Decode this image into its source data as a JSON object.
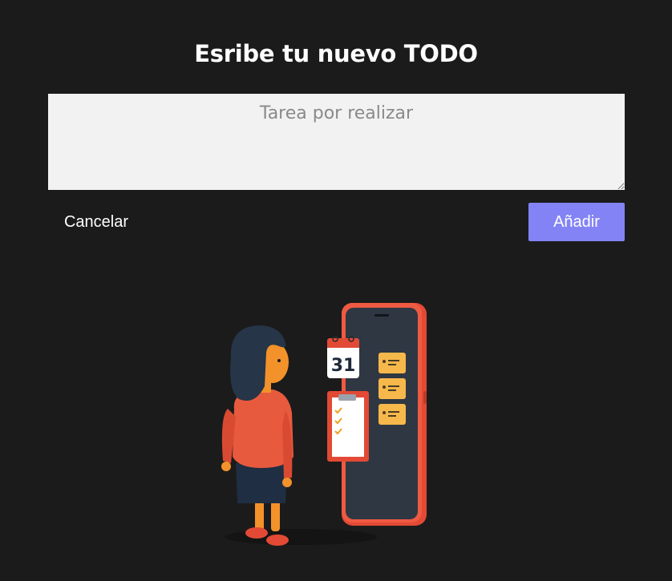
{
  "form": {
    "title": "Esribe tu nuevo TODO",
    "task_placeholder": "Tarea por realizar",
    "task_value": "",
    "cancel_label": "Cancelar",
    "add_label": "Añadir"
  },
  "illustration": {
    "calendar_day": "31"
  },
  "colors": {
    "background": "#1b1b1b",
    "input_background": "#f2f2f2",
    "accent": "#8383f6",
    "phone_frame": "#e24a35",
    "card_yellow": "#f7b84b"
  }
}
